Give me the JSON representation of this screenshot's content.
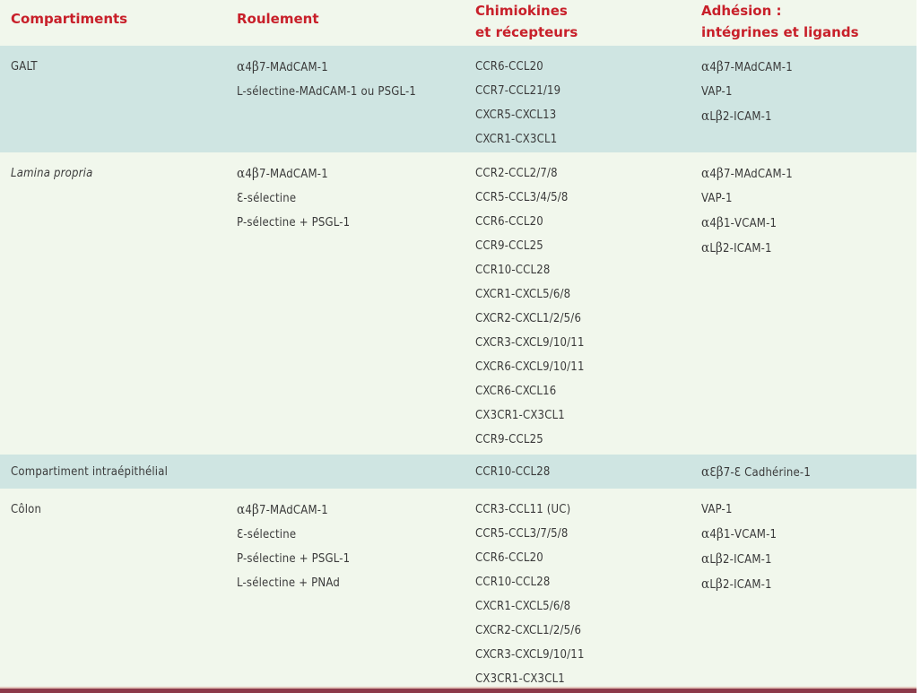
{
  "table": {
    "headers": [
      {
        "lines": [
          "Compartiments"
        ]
      },
      {
        "lines": [
          "Roulement"
        ]
      },
      {
        "lines": [
          "Chimiokines",
          "et récepteurs"
        ]
      },
      {
        "lines": [
          "Adhésion :",
          "intégrines et ligands"
        ]
      }
    ],
    "rows": [
      {
        "compartiment": "GALT",
        "italic": false,
        "roulement": [
          "α4β7-MAdCAM-1",
          "L-sélectine-MAdCAM-1 ou PSGL-1"
        ],
        "chimiokines": [
          "CCR6-CCL20",
          "CCR7-CCL21/19",
          "CXCR5-CXCL13",
          "CXCR1-CX3CL1"
        ],
        "adhesion": [
          "α4β7-MAdCAM-1",
          "VAP-1",
          "αLβ2-ICAM-1"
        ]
      },
      {
        "compartiment": "Lamina propria",
        "italic": true,
        "roulement": [
          "α4β7-MAdCAM-1",
          "Ɛ-sélectine",
          "P-sélectine + PSGL-1"
        ],
        "chimiokines": [
          "CCR2-CCL2/7/8",
          "CCR5-CCL3/4/5/8",
          "CCR6-CCL20",
          "CCR9-CCL25",
          "CCR10-CCL28",
          "CXCR1-CXCL5/6/8",
          "CXCR2-CXCL1/2/5/6",
          "CXCR3-CXCL9/10/11",
          "CXCR6-CXCL9/10/11",
          "CXCR6-CXCL16",
          "CX3CR1-CX3CL1",
          "CCR9-CCL25"
        ],
        "adhesion": [
          "α4β7-MAdCAM-1",
          "VAP-1",
          "α4β1-VCAM-1",
          "αLβ2-ICAM-1"
        ]
      },
      {
        "compartiment": "Compartiment intraépithélial",
        "italic": false,
        "roulement": [],
        "chimiokines": [
          "CCR10-CCL28"
        ],
        "adhesion": [
          "αƐβ7-Ɛ Cadhérine-1"
        ]
      },
      {
        "compartiment": "Côlon",
        "italic": false,
        "roulement": [
          "α4β7-MAdCAM-1",
          "Ɛ-sélectine",
          "P-sélectine + PSGL-1",
          "L-sélectine + PNAd"
        ],
        "chimiokines": [
          "CCR3-CCL11 (UC)",
          "CCR5-CCL3/7/5/8",
          "CCR6-CCL20",
          "CCR10-CCL28",
          "CXCR1-CXCL5/6/8",
          "CXCR2-CXCL1/2/5/6",
          "CXCR3-CXCL9/10/11",
          "CX3CR1-CX3CL1"
        ],
        "adhesion": [
          "VAP-1",
          "α4β1-VCAM-1",
          "αLβ2-ICAM-1",
          "αLβ2-ICAM-1"
        ]
      }
    ]
  },
  "colors": {
    "header_text": "#c8202a",
    "row_teal": "#cfe5e2",
    "row_light": "#f1f7ec",
    "body_text": "#3b3b3b",
    "bottom_rule": "#8c3a4a"
  }
}
